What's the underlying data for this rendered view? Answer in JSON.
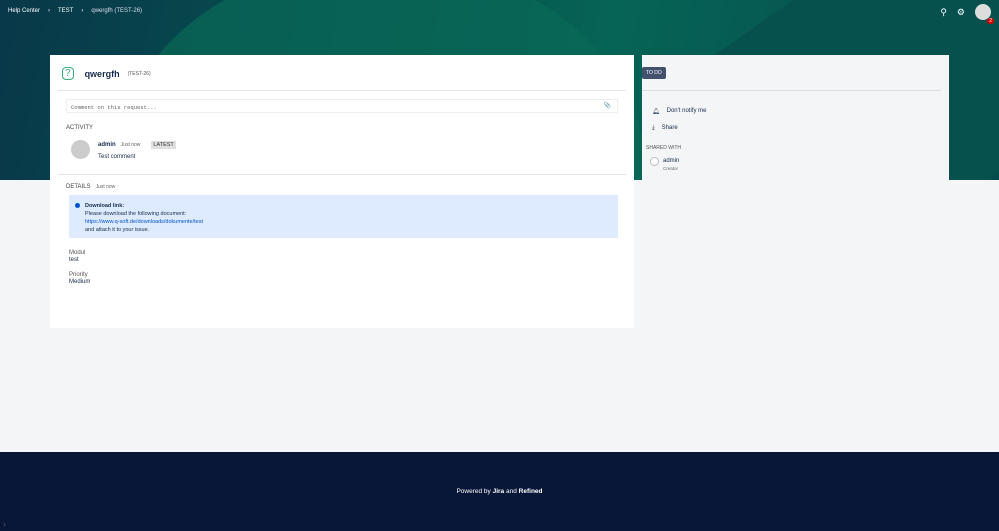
{
  "breadcrumb": [
    "Help Center",
    "TEST",
    "qwergfh (TEST-26)"
  ],
  "header": {
    "notification_count": "2"
  },
  "request": {
    "title": "qwergfh",
    "key": "(TEST-26)",
    "comment_placeholder": "Comment on this request..."
  },
  "activity": {
    "heading": "ACTIVITY",
    "author": "admin",
    "time": "Just now",
    "badge": "LATEST",
    "text": "Test comment"
  },
  "details": {
    "heading": "DETAILS",
    "time": "Just now",
    "info": {
      "title": "Download link:",
      "line1": "Please download the following document:",
      "link": "https://www.q-soft.de/downloads/dokumente/test",
      "line2": "and attach it to your issue."
    },
    "fields": [
      {
        "label": "Modul",
        "value": "test"
      },
      {
        "label": "Priority",
        "value": "Medium"
      }
    ]
  },
  "sidebar": {
    "status": "TO DO",
    "notify": "Don't notify me",
    "share": "Share",
    "shared_heading": "SHARED WITH",
    "shared_name": "admin",
    "shared_role": "Creator"
  },
  "footer": {
    "prefix": "Powered by",
    "jira": "Jira",
    "and": "and",
    "refined": "Refined"
  }
}
